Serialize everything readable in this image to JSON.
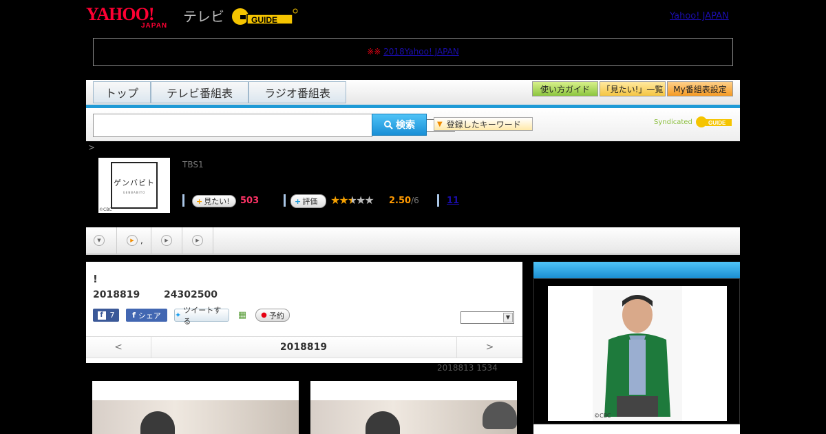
{
  "header": {
    "yahoo_logo": "YAHOO!",
    "yahoo_japan": "JAPAN",
    "tv_label": "テレビ",
    "gguide_logo": "G GUIDE",
    "yahoo_link": "Yahoo! JAPAN"
  },
  "notice": {
    "marks": "※※",
    "link": "2018Yahoo! JAPAN"
  },
  "nav": {
    "tabs": [
      "トップ",
      "テレビ番組表",
      "ラジオ番組表"
    ],
    "right_buttons": [
      "使い方ガイド",
      "「見たい!」一覧",
      "My番組表設定"
    ]
  },
  "search": {
    "button_label": "検索",
    "keyword_button": "登録したキーワード",
    "syndicated": "Syndicated"
  },
  "breadcrumb": ">",
  "program": {
    "thumb_title": "ゲンバビト",
    "thumb_sub": "GENBABITO",
    "thumb_copy": "©CBC",
    "channel": "TBS1",
    "want_label": "見たい!",
    "want_count": "503",
    "rate_label": "評価",
    "stars": "★★★★★",
    "rating": "2.50",
    "rating_den": "/6",
    "review_link": "11"
  },
  "subtabs": [
    ",",
    ""
  ],
  "detail": {
    "title": "!",
    "date": "2018819",
    "time": "24302500",
    "fb_count": "7",
    "share_label": "シェア",
    "tweet_label": "ツイートする",
    "reserve_label": "予約",
    "prev": "<",
    "day": "2018819",
    "next": ">",
    "updated": "2018813  1534"
  },
  "side": {
    "copy": "©CBC"
  },
  "colors": {
    "accent": "#1e9ad6",
    "pink": "#ff3366",
    "orange": "#ff9900"
  }
}
